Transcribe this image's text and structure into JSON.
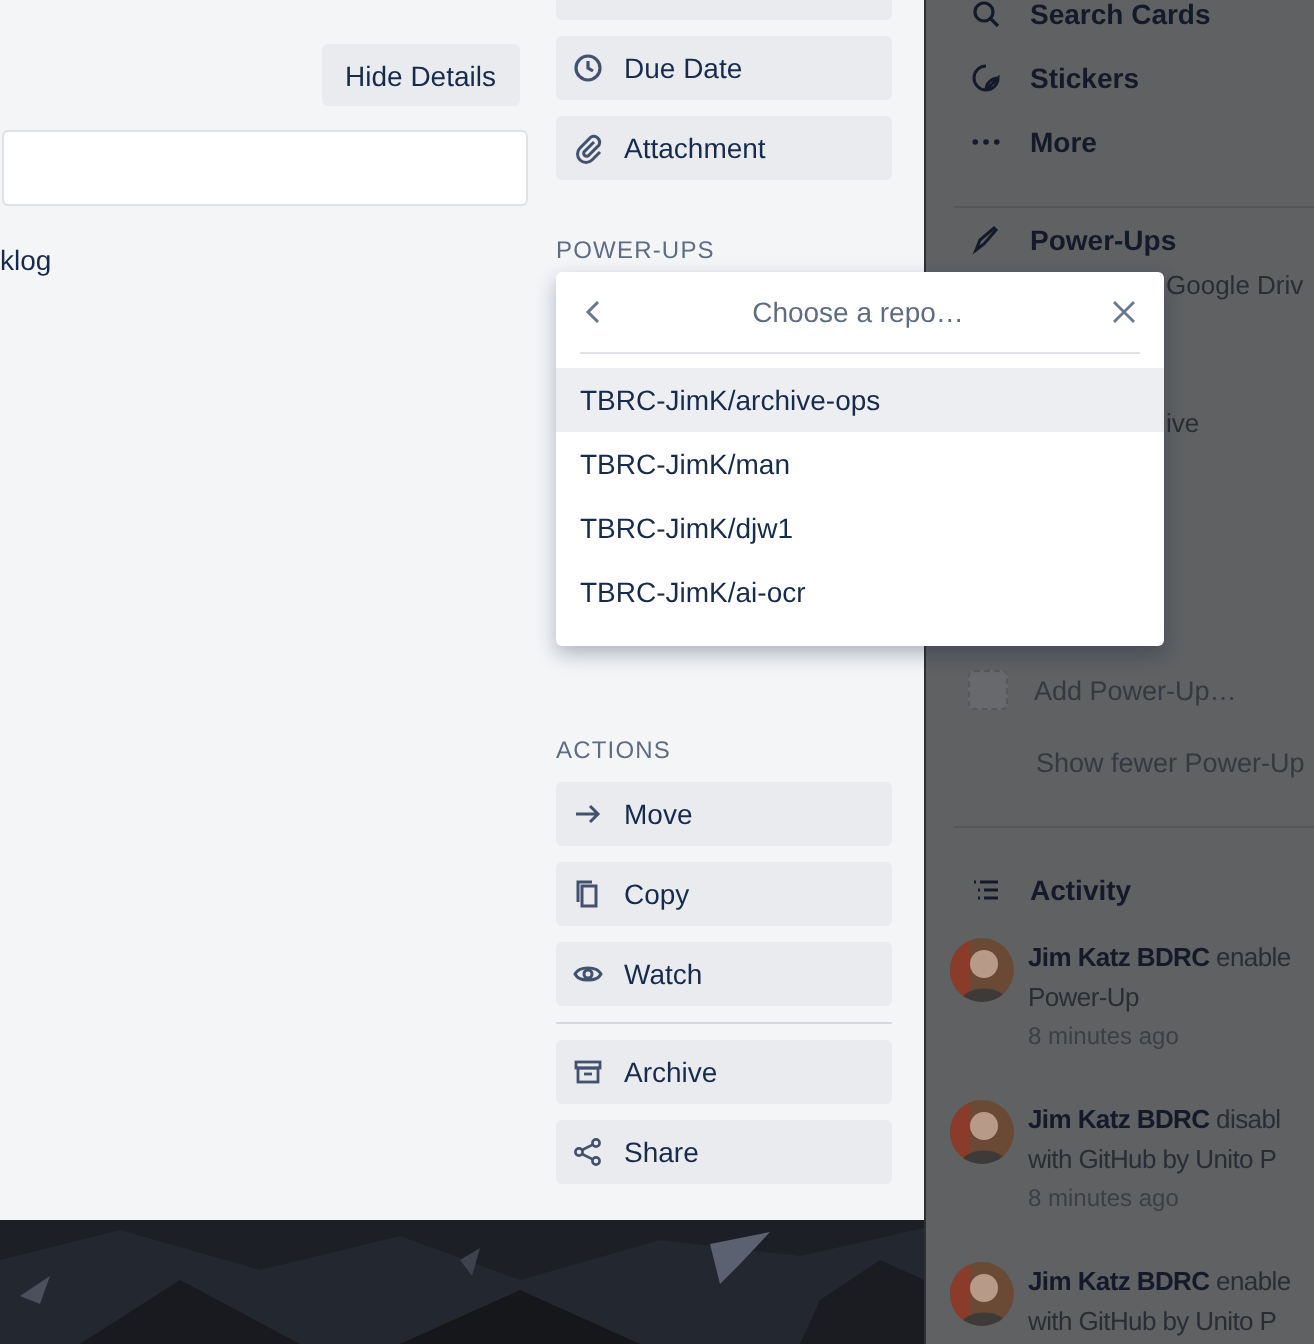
{
  "card": {
    "hide_details_button": "Hide Details",
    "list_fragment": "klog",
    "add_to_card": [
      {
        "label": "Due Date"
      },
      {
        "label": "Attachment"
      }
    ],
    "power_ups_heading": "POWER-UPS",
    "actions_heading": "ACTIONS",
    "actions": [
      {
        "label": "Move"
      },
      {
        "label": "Copy"
      },
      {
        "label": "Watch"
      }
    ],
    "more_actions": [
      {
        "label": "Archive"
      },
      {
        "label": "Share"
      }
    ]
  },
  "repo_picker": {
    "title": "Choose a repo…",
    "items": [
      {
        "label": "TBRC-JimK/archive-ops",
        "selected": true
      },
      {
        "label": "TBRC-JimK/man",
        "selected": false
      },
      {
        "label": "TBRC-JimK/djw1",
        "selected": false
      },
      {
        "label": "TBRC-JimK/ai-ocr",
        "selected": false
      }
    ]
  },
  "board_menu": {
    "items": [
      {
        "label": "Search Cards"
      },
      {
        "label": "Stickers"
      },
      {
        "label": "More"
      }
    ],
    "power_ups": {
      "title": "Power-Ups",
      "fragments": [
        "Google Driv",
        "ive"
      ],
      "add": "Add Power-Up…",
      "show_fewer": "Show fewer Power-Up"
    },
    "activity": {
      "title": "Activity",
      "entries": [
        {
          "lines": [
            "**Jim Katz BDRC** enable",
            "Power-Up"
          ],
          "time": "8 minutes ago"
        },
        {
          "lines": [
            "**Jim Katz BDRC** disabl",
            "with GitHub by Unito P"
          ],
          "time": "8 minutes ago"
        },
        {
          "lines": [
            "**Jim Katz BDRC** enable",
            "with GitHub by Unito P"
          ]
        }
      ]
    }
  }
}
